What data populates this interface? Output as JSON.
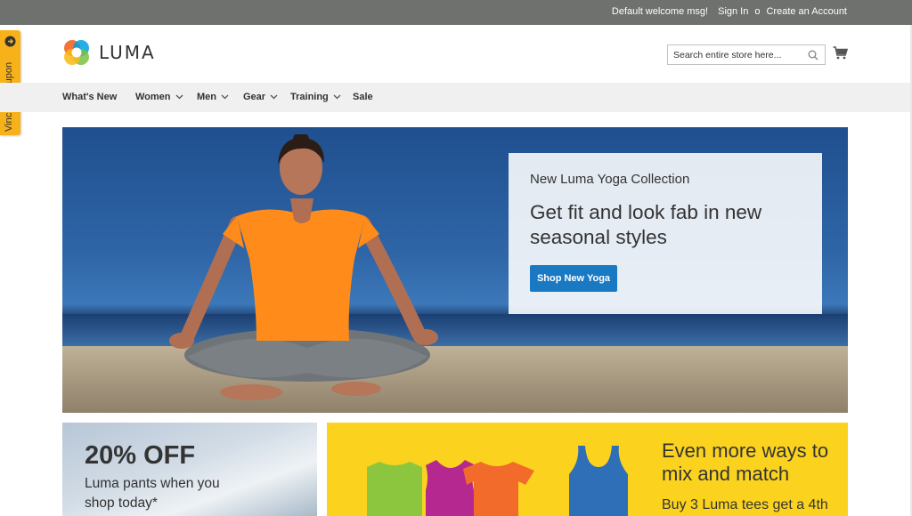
{
  "topbar": {
    "welcome": "Default welcome msg!",
    "sign_in": "Sign In",
    "or": "o",
    "create_account": "Create an Account"
  },
  "header": {
    "logo_text": "LUMA",
    "search_placeholder": "Search entire store here...",
    "icons": [
      "search-icon",
      "cart-icon"
    ]
  },
  "nav": {
    "items": [
      {
        "label": "What's New",
        "has_dropdown": false
      },
      {
        "label": "Women",
        "has_dropdown": true
      },
      {
        "label": "Men",
        "has_dropdown": true
      },
      {
        "label": "Gear",
        "has_dropdown": true
      },
      {
        "label": "Training",
        "has_dropdown": true
      },
      {
        "label": "Sale",
        "has_dropdown": false
      }
    ]
  },
  "coupon_tab": {
    "label": "Vinci un coupon"
  },
  "hero": {
    "kicker": "New Luma Yoga Collection",
    "headline": "Get fit and look fab in new seasonal styles",
    "button_label": "Shop New Yoga"
  },
  "promo_left": {
    "title": "20% OFF",
    "subtitle": "Luma pants when you shop today*"
  },
  "promo_right": {
    "title": "Even more ways to mix and match",
    "subtitle": "Buy 3 Luma tees get a 4th"
  },
  "colors": {
    "topbar": "#6e716e",
    "nav_bg": "#f0f0f0",
    "accent_button": "#1979c3",
    "coupon_tab": "#f7b21a",
    "promo_yellow": "#fbd31f"
  }
}
